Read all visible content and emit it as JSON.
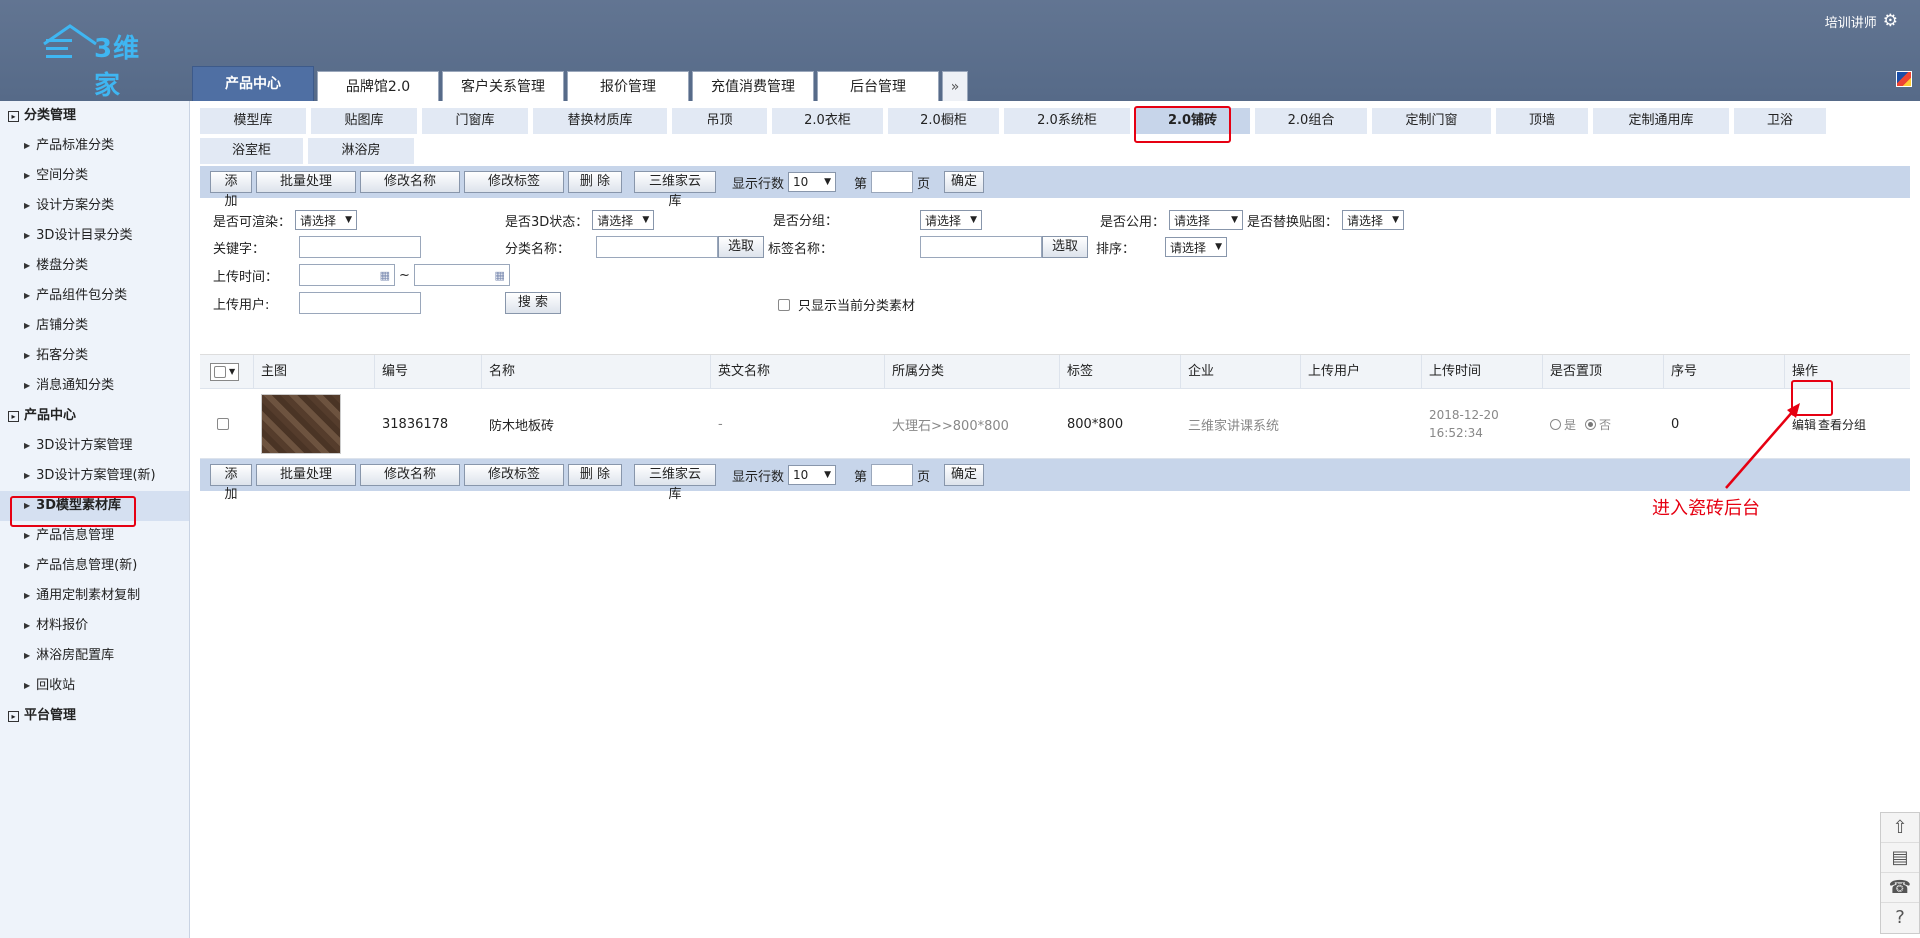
{
  "header": {
    "logo_text": "3维家",
    "user_name": "培训讲师",
    "main_tabs": [
      "产品中心",
      "品牌馆2.0",
      "客户关系管理",
      "报价管理",
      "充值消费管理",
      "后台管理"
    ],
    "more_label": "»"
  },
  "sidebar": {
    "groups": [
      {
        "label": "分类管理",
        "items": [
          "产品标准分类",
          "空间分类",
          "设计方案分类",
          "3D设计目录分类",
          "楼盘分类",
          "产品组件包分类",
          "店铺分类",
          "拓客分类",
          "消息通知分类"
        ]
      },
      {
        "label": "产品中心",
        "items": [
          "3D设计方案管理",
          "3D设计方案管理(新)",
          "3D模型素材库",
          "产品信息管理",
          "产品信息管理(新)",
          "通用定制素材复制",
          "材料报价",
          "淋浴房配置库",
          "回收站"
        ]
      },
      {
        "label": "平台管理",
        "items": []
      }
    ]
  },
  "sub_tabs": [
    "模型库",
    "贴图库",
    "门窗库",
    "替换材质库",
    "吊顶",
    "2.0衣柜",
    "2.0橱柜",
    "2.0系统柜",
    "2.0铺砖",
    "2.0组合",
    "定制门窗",
    "顶墙",
    "定制通用库",
    "卫浴",
    "浴室柜",
    "淋浴房"
  ],
  "toolbar": {
    "add": "添 加",
    "batch": "批量处理",
    "rename": "修改名称",
    "retag": "修改标签",
    "delete": "删 除",
    "cloud": "三维家云库",
    "rows_label": "显示行数",
    "rows_value": "10",
    "page_prefix": "第",
    "page_suffix": "页",
    "confirm": "确定"
  },
  "filters": {
    "renderable": "是否可渲染：",
    "status3d": "是否3D状态：",
    "grouped": "是否分组：",
    "public": "是否公用：",
    "replace_map": "是否替换贴图：",
    "please_select": "请选择",
    "keyword": "关键字：",
    "category_name": "分类名称：",
    "pick": "选取",
    "tag_name": "标签名称：",
    "sort": "排序：",
    "upload_time": "上传时间：",
    "tilde": "~",
    "upload_user": "上传用户:",
    "search": "搜 索",
    "only_current": "只显示当前分类素材"
  },
  "table": {
    "headers": [
      "主图",
      "编号",
      "名称",
      "英文名称",
      "所属分类",
      "标签",
      "企业",
      "上传用户",
      "上传时间",
      "是否置顶",
      "序号",
      "操作"
    ],
    "rows": [
      {
        "id": "31836178",
        "name": "防木地板砖",
        "english_name": "-",
        "category": "大理石>>800*800",
        "tag": "800*800",
        "company": "三维家讲课系统",
        "upload_user": "",
        "upload_date": "2018-12-20",
        "upload_clock": "16:52:34",
        "top_yes": "是",
        "top_no": "否",
        "seq": "0",
        "edit": "编辑",
        "view_group": "查看分组"
      }
    ]
  },
  "annotation": {
    "text": "进入瓷砖后台",
    "color": "#e60012"
  },
  "float_tools": [
    "up-arrow",
    "card",
    "support",
    "help"
  ]
}
